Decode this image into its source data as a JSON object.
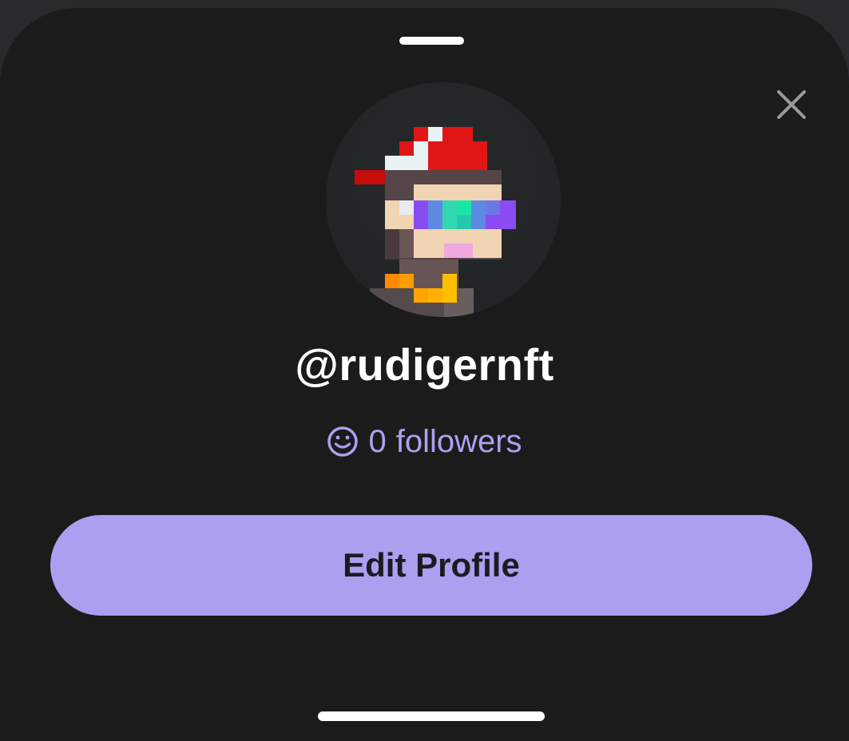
{
  "profile": {
    "username": "@rudigernft",
    "followers_count": "0",
    "followers_label": "followers"
  },
  "actions": {
    "edit_profile_label": "Edit Profile"
  },
  "icons": {
    "close": "close-icon",
    "followers": "smiley-icon",
    "avatar": "pixel-art-avatar"
  },
  "colors": {
    "sheet_background": "#1b1b1c",
    "accent": "#ac9ff0",
    "accent_text": "#aea0f0",
    "button_text": "#1c1b20",
    "username_text": "#ffffff"
  }
}
